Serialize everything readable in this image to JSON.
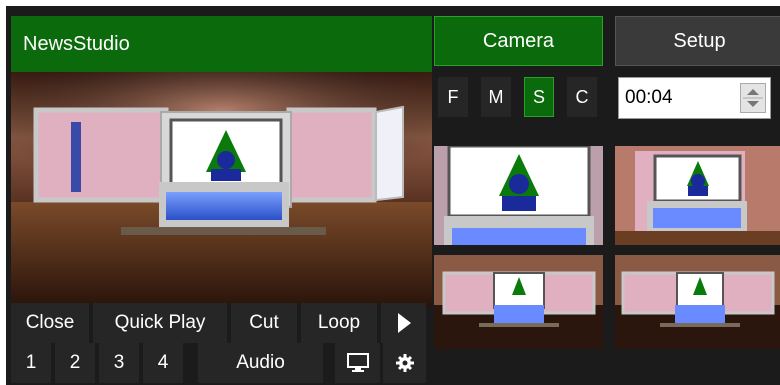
{
  "app": {
    "title": "NewsStudio"
  },
  "preview_controls": {
    "row1": [
      "Close",
      "Quick Play",
      "Cut",
      "Loop"
    ],
    "row2": [
      "1",
      "2",
      "3",
      "4",
      "Audio"
    ],
    "icons": [
      "play-arrow-icon",
      "monitor-icon",
      "gear-icon"
    ]
  },
  "tabs": {
    "camera": "Camera",
    "setup": "Setup",
    "active": "Camera"
  },
  "shot_size_buttons": {
    "labels": [
      "F",
      "M",
      "S",
      "C"
    ],
    "active": "S"
  },
  "duration": {
    "value": "00:04"
  },
  "colors": {
    "accent_green": "#0b6a0b",
    "panel_dark": "#1b1b1b",
    "button_dark": "#262626"
  }
}
